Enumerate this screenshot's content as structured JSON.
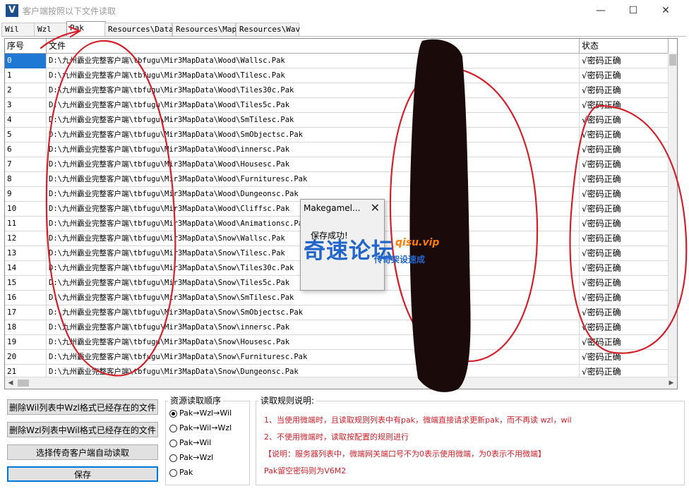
{
  "window": {
    "title": "客户端按照以下文件读取",
    "logo_letter": "V",
    "min_glyph": "—",
    "max_glyph": "☐",
    "close_glyph": "✕"
  },
  "tabs": [
    {
      "label": "Wil"
    },
    {
      "label": "Wzl"
    },
    {
      "label": "Pak"
    },
    {
      "label": "Resources\\Data"
    },
    {
      "label": "Resources\\Map"
    },
    {
      "label": "Resources\\Wav"
    }
  ],
  "active_tab": 2,
  "table": {
    "headers": {
      "index": "序号",
      "file": "文件",
      "status": "状态"
    },
    "rows": [
      {
        "index": "0",
        "file": "D:\\九州霸业完整客户端\\tbfugu\\Mir3MapData\\Wood\\Wallsc.Pak",
        "status": "√密码正确"
      },
      {
        "index": "1",
        "file": "D:\\九州霸业完整客户端\\tbfugu\\Mir3MapData\\Wood\\Tilesc.Pak",
        "status": "√密码正确"
      },
      {
        "index": "2",
        "file": "D:\\九州霸业完整客户端\\tbfugu\\Mir3MapData\\Wood\\Tiles30c.Pak",
        "status": "√密码正确"
      },
      {
        "index": "3",
        "file": "D:\\九州霸业完整客户端\\tbfugu\\Mir3MapData\\Wood\\Tiles5c.Pak",
        "status": "√密码正确"
      },
      {
        "index": "4",
        "file": "D:\\九州霸业完整客户端\\tbfugu\\Mir3MapData\\Wood\\SmTilesc.Pak",
        "status": "√密码正确"
      },
      {
        "index": "5",
        "file": "D:\\九州霸业完整客户端\\tbfugu\\Mir3MapData\\Wood\\SmObjectsc.Pak",
        "status": "√密码正确"
      },
      {
        "index": "6",
        "file": "D:\\九州霸业完整客户端\\tbfugu\\Mir3MapData\\Wood\\innersc.Pak",
        "status": "√密码正确"
      },
      {
        "index": "7",
        "file": "D:\\九州霸业完整客户端\\tbfugu\\Mir3MapData\\Wood\\Housesc.Pak",
        "status": "√密码正确"
      },
      {
        "index": "8",
        "file": "D:\\九州霸业完整客户端\\tbfugu\\Mir3MapData\\Wood\\Furnituresc.Pak",
        "status": "√密码正确"
      },
      {
        "index": "9",
        "file": "D:\\九州霸业完整客户端\\tbfugu\\Mir3MapData\\Wood\\Dungeonsc.Pak",
        "status": "√密码正确"
      },
      {
        "index": "10",
        "file": "D:\\九州霸业完整客户端\\tbfugu\\Mir3MapData\\Wood\\Cliffsc.Pak",
        "status": "√密码正确"
      },
      {
        "index": "11",
        "file": "D:\\九州霸业完整客户端\\tbfugu\\Mir3MapData\\Wood\\Animationsc.Pak",
        "status": "√密码正确"
      },
      {
        "index": "12",
        "file": "D:\\九州霸业完整客户端\\tbfugu\\Mir3MapData\\Snow\\Wallsc.Pak",
        "status": "√密码正确"
      },
      {
        "index": "13",
        "file": "D:\\九州霸业完整客户端\\tbfugu\\Mir3MapData\\Snow\\Tilesc.Pak",
        "status": "√密码正确"
      },
      {
        "index": "14",
        "file": "D:\\九州霸业完整客户端\\tbfugu\\Mir3MapData\\Snow\\Tiles30c.Pak",
        "status": "√密码正确"
      },
      {
        "index": "15",
        "file": "D:\\九州霸业完整客户端\\tbfugu\\Mir3MapData\\Snow\\Tiles5c.Pak",
        "status": "√密码正确"
      },
      {
        "index": "16",
        "file": "D:\\九州霸业完整客户端\\tbfugu\\Mir3MapData\\Snow\\SmTilesc.Pak",
        "status": "√密码正确"
      },
      {
        "index": "17",
        "file": "D:\\九州霸业完整客户端\\tbfugu\\Mir3MapData\\Snow\\SmObjectsc.Pak",
        "status": "√密码正确"
      },
      {
        "index": "18",
        "file": "D:\\九州霸业完整客户端\\tbfugu\\Mir3MapData\\Snow\\innersc.Pak",
        "status": "√密码正确"
      },
      {
        "index": "19",
        "file": "D:\\九州霸业完整客户端\\tbfugu\\Mir3MapData\\Snow\\Housesc.Pak",
        "status": "√密码正确"
      },
      {
        "index": "20",
        "file": "D:\\九州霸业完整客户端\\tbfugu\\Mir3MapData\\Snow\\Furnituresc.Pak",
        "status": "√密码正确"
      },
      {
        "index": "21",
        "file": "D:\\九州霸业完整客户端\\tbfugu\\Mir3MapData\\Snow\\Dungeonsc.Pak",
        "status": "√密码正确"
      }
    ],
    "selected_row": 0
  },
  "buttons": {
    "delete_wil": "删除Wil列表中Wzl格式已经存在的文件",
    "delete_wzl": "删除Wzl列表中Wil格式已经存在的文件",
    "auto_read": "选择传奇客户端自动读取",
    "save": "保存"
  },
  "read_order": {
    "title": "资源读取顺序",
    "options": [
      {
        "label": "Pak→Wzl→Wil",
        "checked": true
      },
      {
        "label": "Pak→Wil→Wzl",
        "checked": false
      },
      {
        "label": "Pak→Wil",
        "checked": false
      },
      {
        "label": "Pak→Wzl",
        "checked": false
      },
      {
        "label": "Pak",
        "checked": false
      }
    ]
  },
  "rules": {
    "title": "读取规则说明:",
    "lines": [
      "1、当使用微端时，且读取规则列表中有pak，微端直接请求更新pak，而不再读 wzl，wil",
      "2、不使用微端时，读取按配置的规则进行",
      "【说明：服务器列表中，微端网关端口号不为0表示使用微端，为0表示不用微端】",
      "Pak留空密码则为V6M2"
    ]
  },
  "dialog": {
    "title": "Makegamel...",
    "message": "保存成功!",
    "close_glyph": "✕"
  },
  "watermark": {
    "main": "奇速论坛",
    "url": "qisu.vip",
    "sub": "传奇架设速成"
  },
  "colors": {
    "selection": "#1e78d4",
    "rule_text": "#d0202a",
    "annotation": "#d4202a",
    "watermark_blue": "#2266cc",
    "watermark_orange": "#ff7a00"
  }
}
